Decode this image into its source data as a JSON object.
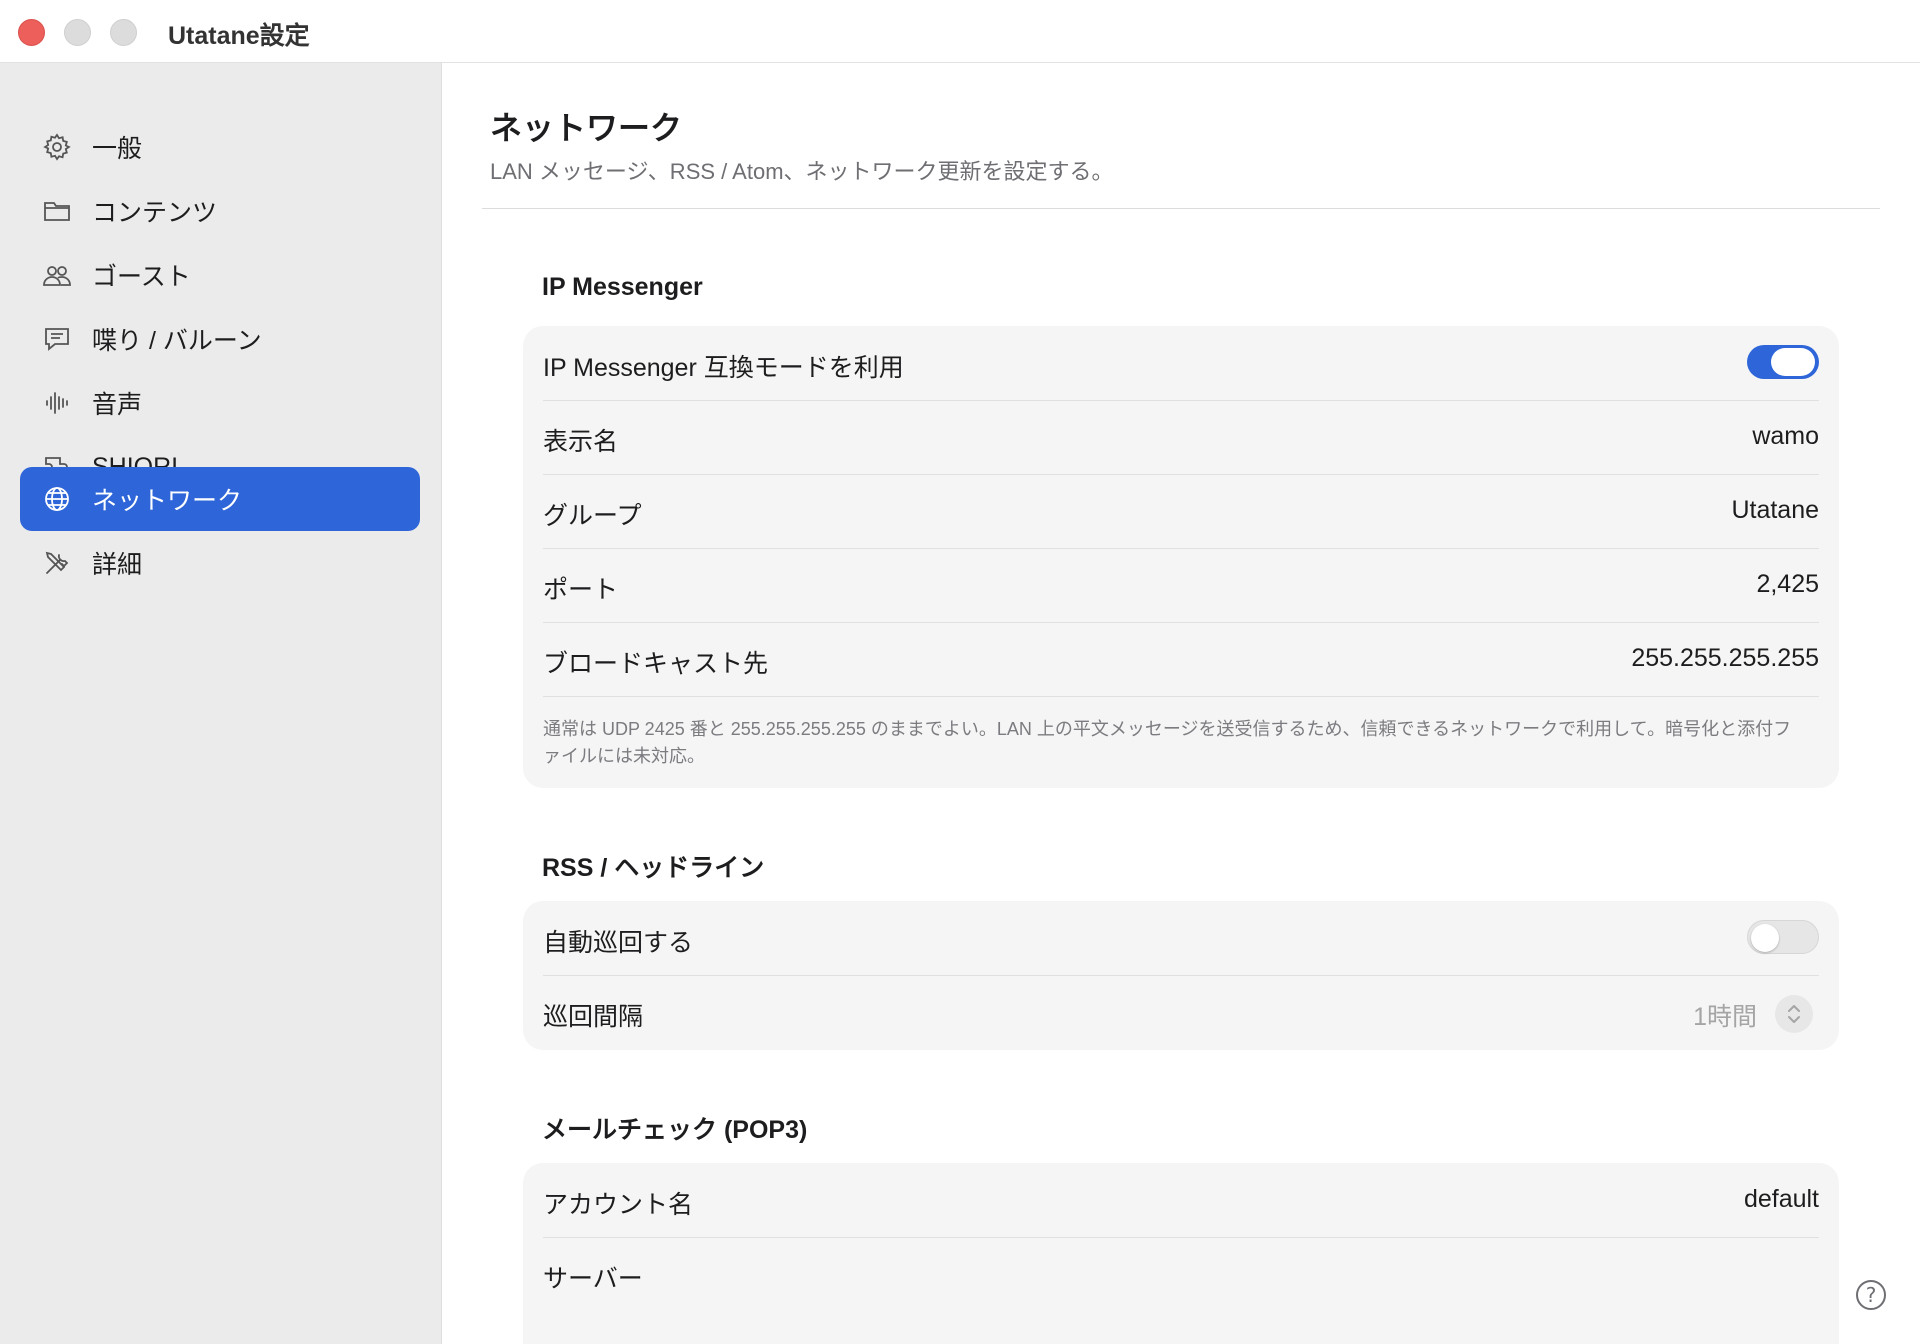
{
  "window": {
    "title": "Utatane設定"
  },
  "sidebar": {
    "items": [
      {
        "label": "一般",
        "icon": "gear-icon"
      },
      {
        "label": "コンテンツ",
        "icon": "folder-icon"
      },
      {
        "label": "ゴースト",
        "icon": "people-icon"
      },
      {
        "label": "喋り / バルーン",
        "icon": "speech-bubble-icon"
      },
      {
        "label": "音声",
        "icon": "waveform-icon"
      },
      {
        "label": "SHIORI",
        "icon": "plugin-icon"
      },
      {
        "label": "ネットワーク",
        "icon": "globe-icon",
        "active": true
      },
      {
        "label": "詳細",
        "icon": "tools-icon"
      }
    ]
  },
  "page": {
    "title": "ネットワーク",
    "subtitle": "LAN メッセージ、RSS / Atom、ネットワーク更新を設定する。"
  },
  "ipmsg": {
    "title": "IP Messenger",
    "compat_label": "IP Messenger 互換モードを利用",
    "compat_on": true,
    "name_label": "表示名",
    "name_value": "wamo",
    "group_label": "グループ",
    "group_value": "Utatane",
    "port_label": "ポート",
    "port_value": "2,425",
    "broadcast_label": "ブロードキャスト先",
    "broadcast_value": "255.255.255.255",
    "note": "通常は UDP 2425 番と 255.255.255.255 のままでよい。LAN 上の平文メッセージを送受信するため、信頼できるネットワークで利用して。暗号化と添付ファイルには未対応。"
  },
  "rss": {
    "title": "RSS / ヘッドライン",
    "auto_label": "自動巡回する",
    "auto_on": false,
    "interval_label": "巡回間隔",
    "interval_value": "1時間"
  },
  "mail": {
    "title": "メールチェック (POP3)",
    "account_label": "アカウント名",
    "account_value": "default",
    "server_label": "サーバー",
    "server_value": ""
  },
  "help": {
    "glyph": "?"
  },
  "colors": {
    "accent": "#2e65d8",
    "close": "#ec5f5b",
    "sidebar_bg": "#ebebeb",
    "card_bg": "#f5f5f5"
  }
}
